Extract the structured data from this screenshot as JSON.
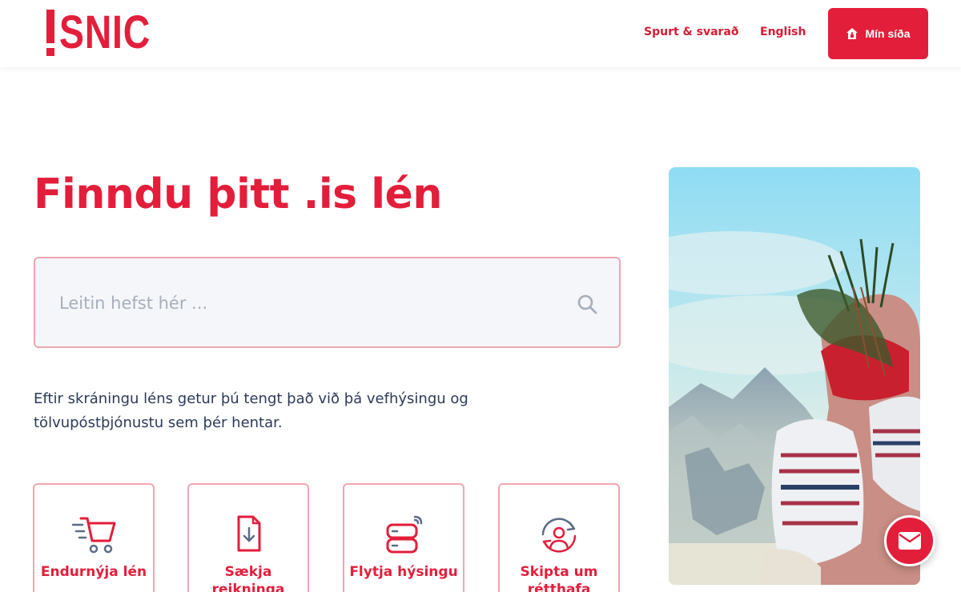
{
  "brand": {
    "logo_text": "SNIC",
    "logo_mark": "!"
  },
  "nav": {
    "faq_label": "Spurt & svarað",
    "lang_label": "English",
    "my_page_label": "Mín síða"
  },
  "hero": {
    "title": "Finndu þitt .is lén",
    "search_placeholder": "Leitin hefst hér ...",
    "intro": "Eftir skráningu léns getur þú tengt það við þá vefhýsingu og tölvupóstþjónustu sem þér hentar."
  },
  "cards": [
    {
      "label": "Endurnýja lén",
      "icon": "shopping-cart-icon"
    },
    {
      "label": "Sækja reikninga",
      "icon": "file-download-icon"
    },
    {
      "label": "Flytja hýsingu",
      "icon": "server-transfer-icon"
    },
    {
      "label": "Skipta um rétthafa",
      "icon": "user-swap-icon"
    }
  ],
  "colors": {
    "brand_red": "#e31e3b",
    "card_border": "#efa6b1",
    "text_dark": "#1f2d4d"
  },
  "fab": {
    "icon": "mail-icon"
  }
}
